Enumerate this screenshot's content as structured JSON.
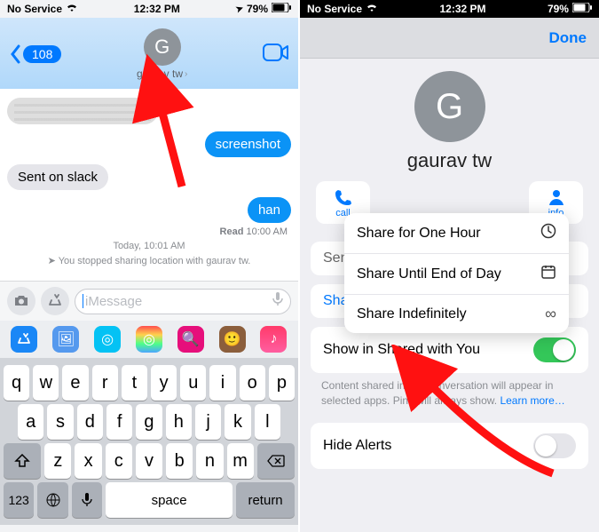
{
  "status_left": {
    "carrier": "No Service",
    "time": "12:32 PM",
    "battery_pct": "79%",
    "location_arrow": "➤"
  },
  "status_right": {
    "carrier": "No Service",
    "time": "12:32 PM",
    "battery_pct": "79%"
  },
  "left": {
    "back_count": "108",
    "avatar_initial": "G",
    "contact_name": "gaurav tw",
    "msgs": {
      "m1": "screenshot",
      "m2": "Sent on slack",
      "m3": "han"
    },
    "read": "Read 10:00 AM",
    "sys_time": "Today, 10:01 AM",
    "sys_text": "You stopped sharing location with gaurav tw.",
    "input_placeholder": "iMessage",
    "keyboard": {
      "r1": [
        "q",
        "w",
        "e",
        "r",
        "t",
        "y",
        "u",
        "i",
        "o",
        "p"
      ],
      "r2": [
        "a",
        "s",
        "d",
        "f",
        "g",
        "h",
        "j",
        "k",
        "l"
      ],
      "r3": [
        "z",
        "x",
        "c",
        "v",
        "b",
        "n",
        "m"
      ],
      "num": "123",
      "space": "space",
      "return": "return"
    }
  },
  "right": {
    "done": "Done",
    "avatar_initial": "G",
    "contact_name": "gaurav tw",
    "quick": {
      "call": "call",
      "info": "info"
    },
    "send_label": "Sen",
    "share_row": "Share My Location",
    "shared_with_you": "Show in Shared with You",
    "shared_note": "Content shared in this conversation will appear in selected apps. Pins will always show.",
    "learn_more": "Learn more…",
    "hide_alerts": "Hide Alerts",
    "popup": {
      "r1": "Share for One Hour",
      "r2": "Share Until End of Day",
      "r3": "Share Indefinitely"
    }
  }
}
